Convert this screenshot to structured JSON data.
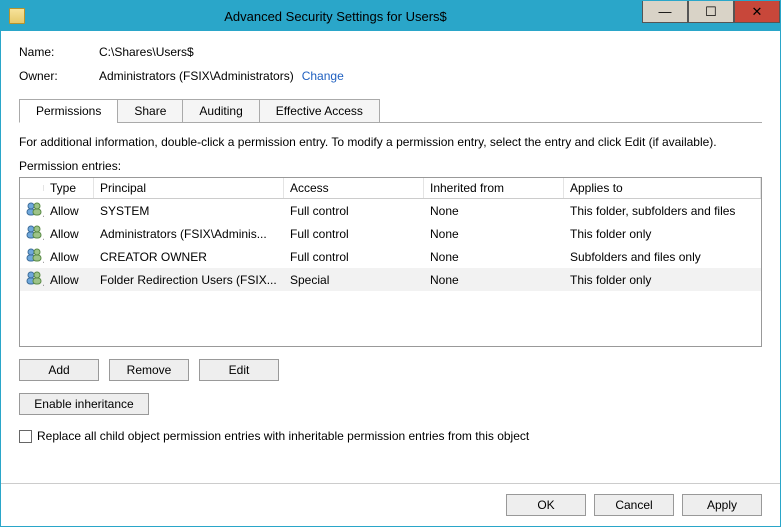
{
  "window": {
    "title": "Advanced Security Settings for Users$"
  },
  "fields": {
    "name_label": "Name:",
    "name_value": "C:\\Shares\\Users$",
    "owner_label": "Owner:",
    "owner_value": "Administrators (FSIX\\Administrators)",
    "change_link": "Change"
  },
  "tabs": {
    "permissions": "Permissions",
    "share": "Share",
    "auditing": "Auditing",
    "effective": "Effective Access"
  },
  "info_text": "For additional information, double-click a permission entry. To modify a permission entry, select the entry and click Edit (if available).",
  "entries_label": "Permission entries:",
  "grid": {
    "headers": {
      "type": "Type",
      "principal": "Principal",
      "access": "Access",
      "inherited": "Inherited from",
      "applies": "Applies to"
    },
    "rows": [
      {
        "type": "Allow",
        "principal": "SYSTEM",
        "access": "Full control",
        "inherited": "None",
        "applies": "This folder, subfolders and files"
      },
      {
        "type": "Allow",
        "principal": "Administrators (FSIX\\Adminis...",
        "access": "Full control",
        "inherited": "None",
        "applies": "This folder only"
      },
      {
        "type": "Allow",
        "principal": "CREATOR OWNER",
        "access": "Full control",
        "inherited": "None",
        "applies": "Subfolders and files only"
      },
      {
        "type": "Allow",
        "principal": "Folder Redirection Users (FSIX...",
        "access": "Special",
        "inherited": "None",
        "applies": "This folder only"
      }
    ]
  },
  "buttons": {
    "add": "Add",
    "remove": "Remove",
    "edit": "Edit",
    "enable_inheritance": "Enable inheritance",
    "ok": "OK",
    "cancel": "Cancel",
    "apply": "Apply"
  },
  "checkbox_label": "Replace all child object permission entries with inheritable permission entries from this object"
}
